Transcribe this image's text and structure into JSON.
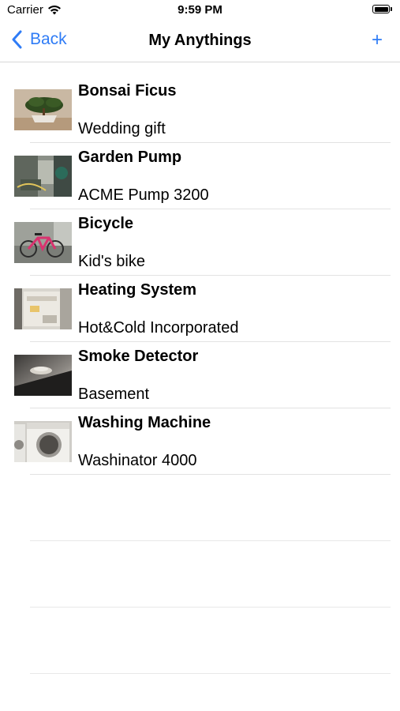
{
  "status_bar": {
    "carrier": "Carrier",
    "time": "9:59 PM"
  },
  "nav": {
    "back_label": "Back",
    "title": "My Anythings",
    "add_label": "+",
    "accent_color": "#2f7cf6"
  },
  "items": [
    {
      "title": "Bonsai Ficus",
      "subtitle": "Wedding gift",
      "thumb_icon": "bonsai-photo"
    },
    {
      "title": "Garden Pump",
      "subtitle": "ACME Pump 3200",
      "thumb_icon": "garden-pump-photo"
    },
    {
      "title": "Bicycle",
      "subtitle": "Kid's bike",
      "thumb_icon": "bicycle-photo"
    },
    {
      "title": "Heating System",
      "subtitle": "Hot&Cold Incorporated",
      "thumb_icon": "heating-system-photo"
    },
    {
      "title": "Smoke Detector",
      "subtitle": "Basement",
      "thumb_icon": "smoke-detector-photo"
    },
    {
      "title": "Washing Machine",
      "subtitle": "Washinator 4000",
      "thumb_icon": "washing-machine-photo"
    }
  ]
}
